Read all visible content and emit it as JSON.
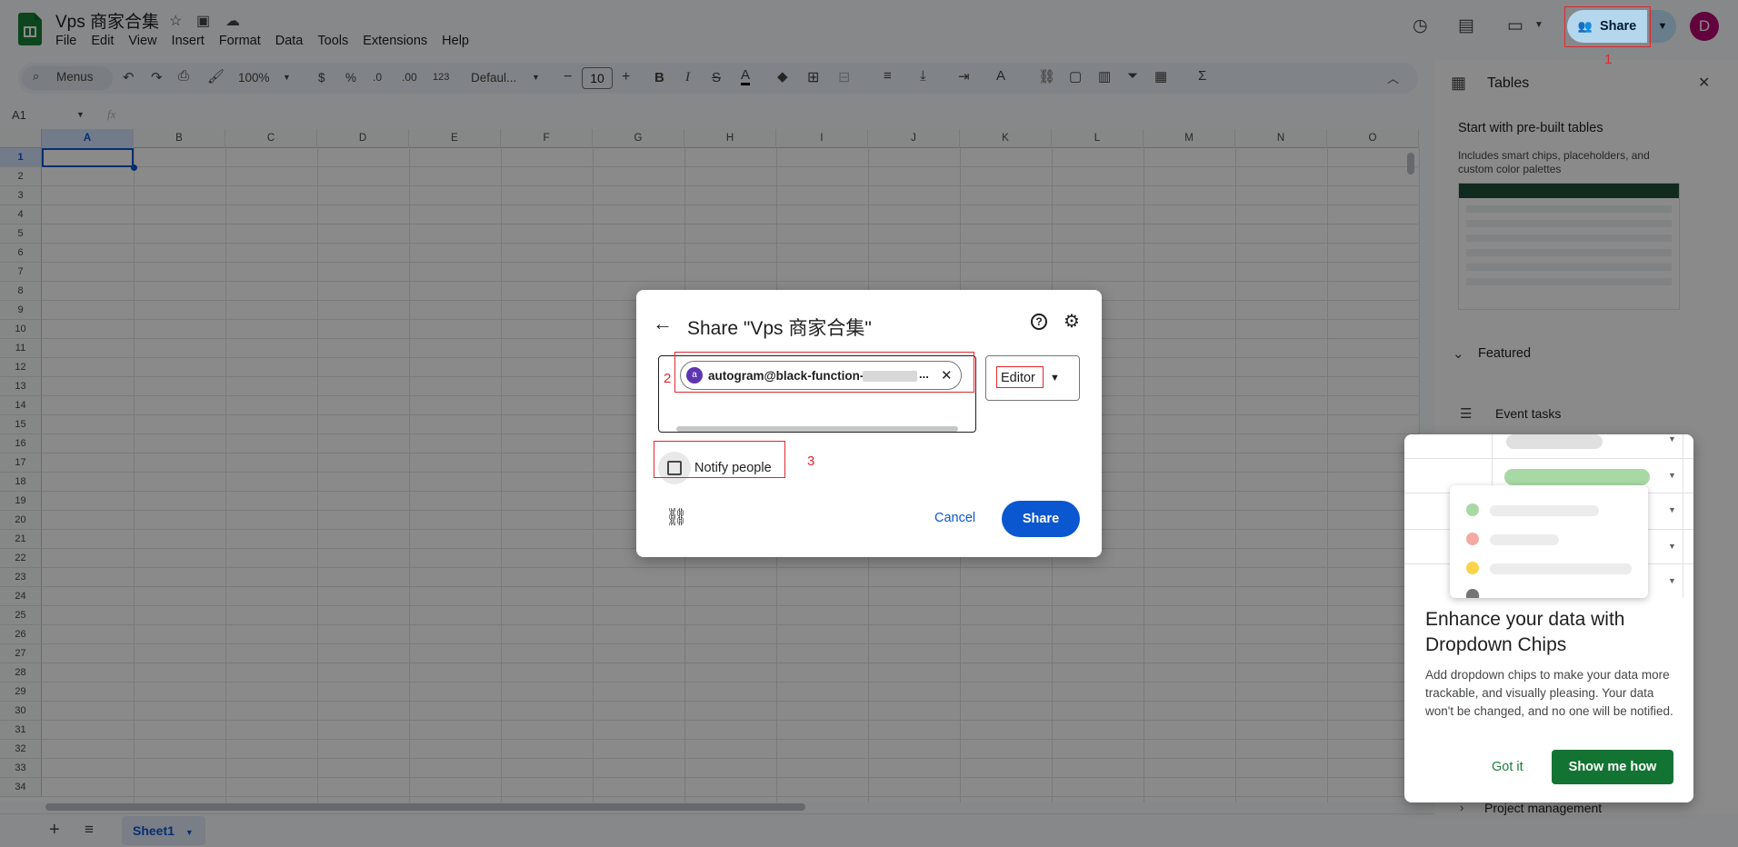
{
  "doc": {
    "title": "Vps 商家合集"
  },
  "menu": [
    "File",
    "Edit",
    "View",
    "Insert",
    "Format",
    "Data",
    "Tools",
    "Extensions",
    "Help"
  ],
  "header": {
    "share_label": "Share",
    "avatar_letter": "D"
  },
  "toolbar": {
    "search_label": "Menus",
    "zoom": "100%",
    "currency": "$",
    "percent": "%",
    "dec_less": ".0",
    "dec_more": ".00",
    "number_format": "123",
    "font": "Defaul...",
    "font_size": "10"
  },
  "formula": {
    "namebox": "A1",
    "fx": "fx"
  },
  "grid": {
    "columns": [
      "A",
      "B",
      "C",
      "D",
      "E",
      "F",
      "G",
      "H",
      "I",
      "J",
      "K",
      "L",
      "M",
      "N",
      "O"
    ],
    "rows": [
      "1",
      "2",
      "3",
      "4",
      "5",
      "6",
      "7",
      "8",
      "9",
      "10",
      "11",
      "12",
      "13",
      "14",
      "15",
      "16",
      "17",
      "18",
      "19",
      "20",
      "21",
      "22",
      "23",
      "24",
      "25",
      "26",
      "27",
      "28",
      "29",
      "30",
      "31",
      "32",
      "33",
      "34"
    ]
  },
  "sheets": [
    {
      "name": "Sheet1"
    }
  ],
  "panel": {
    "title": "Tables",
    "prebuilt_title": "Start with pre-built tables",
    "prebuilt_desc": "Includes smart chips, placeholders, and custom color palettes",
    "featured": "Featured",
    "event_tasks": "Event tasks",
    "project_management": "Project management"
  },
  "dialog": {
    "title": "Share \"Vps 商家合集\"",
    "chip_initial": "a",
    "chip_email": "autogram@black-function-",
    "chip_ellipsis": "...",
    "role": "Editor",
    "notify_label": "Notify people",
    "cancel_label": "Cancel",
    "share_label": "Share"
  },
  "annotations": {
    "n1": "1",
    "n2": "2",
    "n3": "3"
  },
  "tip": {
    "title": "Enhance your data with Dropdown Chips",
    "body": "Add dropdown chips to make your data more trackable, and visually pleasing. Your data won't be changed, and no one will be notified.",
    "got_it": "Got it",
    "show_me": "Show me how"
  },
  "colors": {
    "accent": "#0b57d0",
    "share_bg": "#c2e7ff",
    "green": "#188038",
    "annotation": "#e0282e"
  }
}
